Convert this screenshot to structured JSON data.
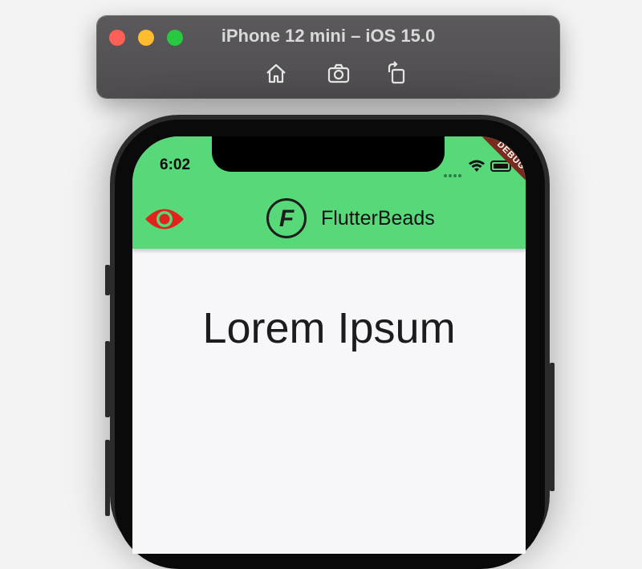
{
  "simulator": {
    "title": "iPhone 12 mini – iOS 15.0",
    "toolbar_icons": [
      "home-icon",
      "screenshot-icon",
      "rotate-icon"
    ]
  },
  "status_bar": {
    "time": "6:02",
    "debug_banner": "DEBUG"
  },
  "app_bar": {
    "brand_name": "FlutterBeads",
    "logo_letter": "F",
    "leading_icon": "eye-icon",
    "background_color": "#57d979",
    "icon_color": "#e0241b"
  },
  "body": {
    "headline": "Lorem Ipsum"
  }
}
